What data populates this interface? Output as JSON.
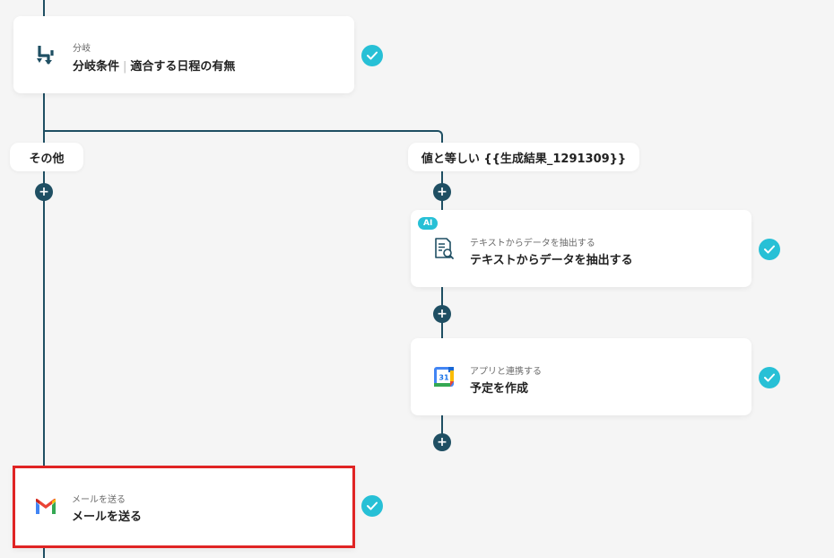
{
  "colors": {
    "line": "#1f4f63",
    "check": "#27c0d6",
    "selection": "#e02424",
    "background": "#f5f5f5"
  },
  "branch_card": {
    "subtitle": "分岐",
    "title_main": "分岐条件",
    "title_detail": "適合する日程の有無",
    "icon": "branch-icon"
  },
  "branches": {
    "left_label": "その他",
    "right_label": "値と等しい {{生成結果_1291309}}"
  },
  "extract_card": {
    "badge": "AI",
    "subtitle": "テキストからデータを抽出する",
    "title": "テキストからデータを抽出する",
    "icon": "document-search-icon"
  },
  "calendar_card": {
    "subtitle": "アプリと連携する",
    "title": "予定を作成",
    "icon": "google-calendar-icon",
    "icon_text": "31"
  },
  "mail_card": {
    "subtitle": "メールを送る",
    "title": "メールを送る",
    "icon": "gmail-icon"
  },
  "plus_symbol": "+"
}
